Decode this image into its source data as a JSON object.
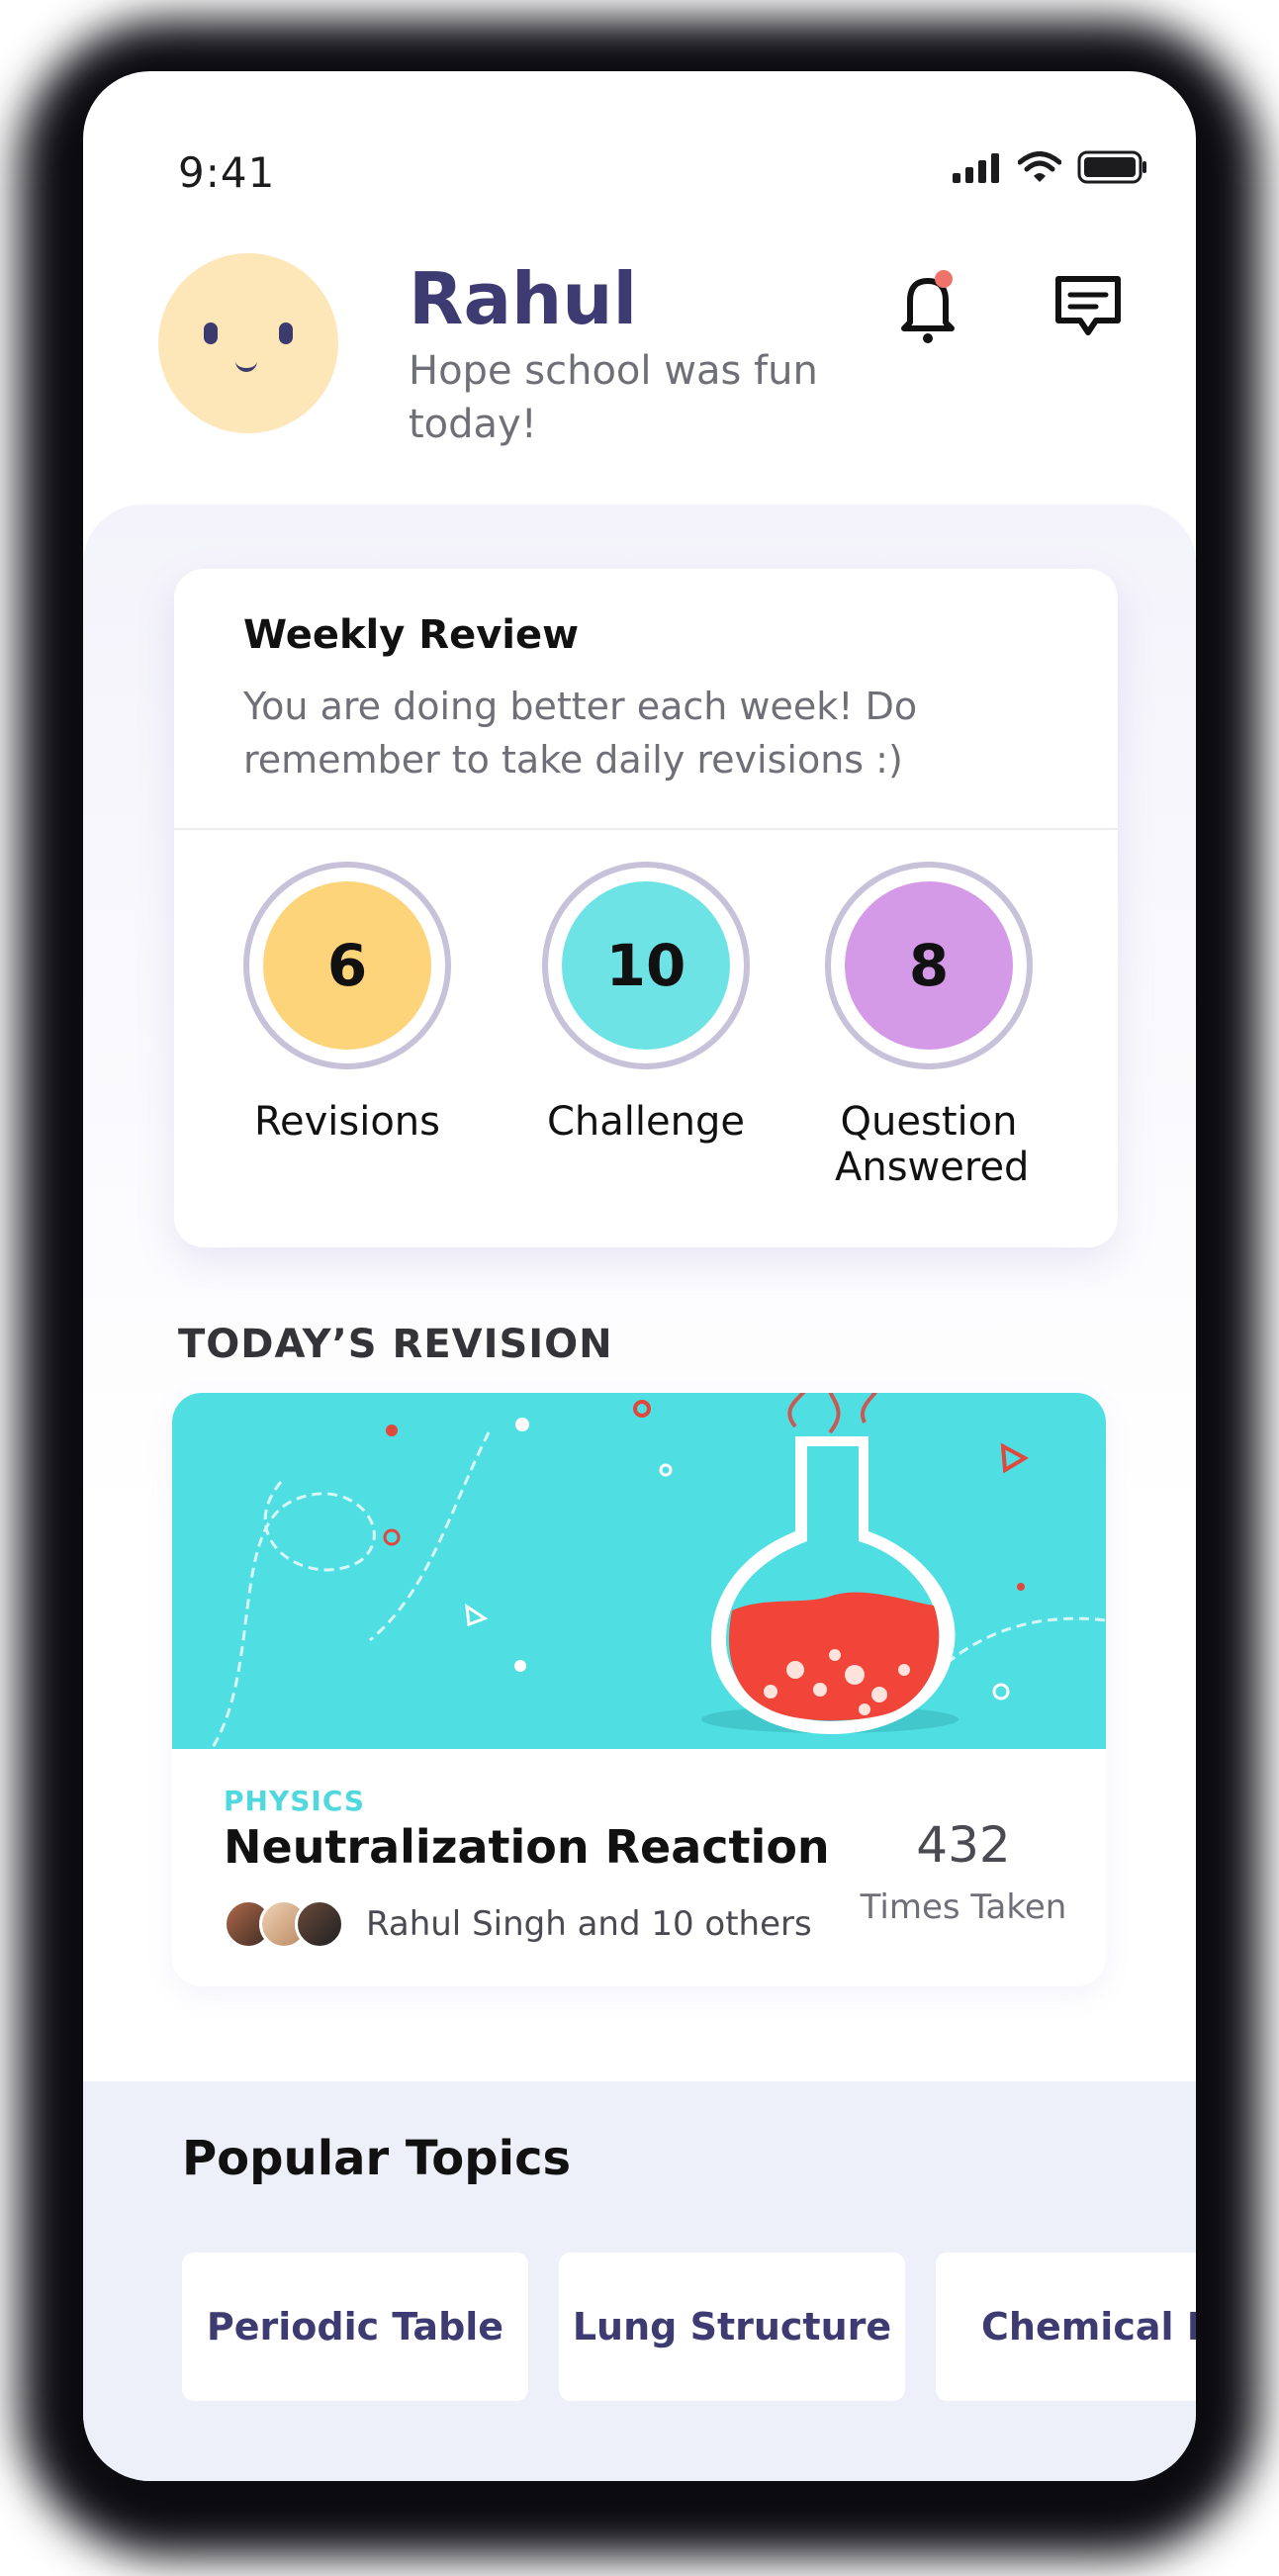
{
  "status_bar": {
    "time": "9:41"
  },
  "header": {
    "name": "Rahul",
    "greeting": "Hope school was fun today!"
  },
  "weekly_review": {
    "title": "Weekly Review",
    "message": "You are doing better each week! Do remember to take daily revisions :)",
    "stats": [
      {
        "value": "6",
        "label": "Revisions",
        "color": "#fdd47a"
      },
      {
        "value": "10",
        "label": "Challenge",
        "color": "#6de3e6"
      },
      {
        "value": "8",
        "label": "Question Answered",
        "color": "#d49ae8"
      }
    ]
  },
  "todays_revision": {
    "section_title": "TODAY’S REVISION",
    "subject": "PHYSICS",
    "title": "Neutralization Reaction",
    "participants": "Rahul Singh and 10 others",
    "times_count": "432",
    "times_label": "Times Taken"
  },
  "popular_topics": {
    "title": "Popular Topics",
    "items": [
      "Periodic Table",
      "Lung Structure",
      "Chemical Re"
    ]
  },
  "colors": {
    "brand": "#3e3b73",
    "accent_cyan": "#4fd8de",
    "notification_dot": "#f0736a"
  },
  "icons": {
    "notification": "bell-icon",
    "messages": "chat-icon"
  }
}
